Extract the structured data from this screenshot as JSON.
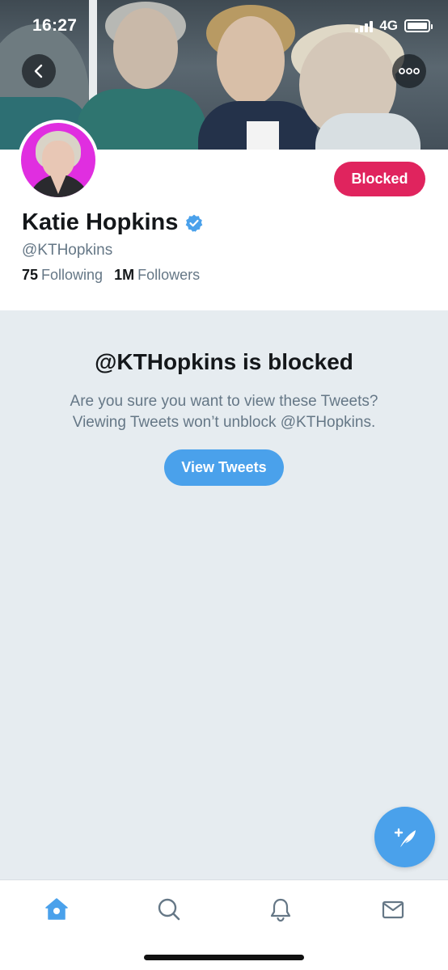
{
  "status_bar": {
    "time": "16:27",
    "network": "4G"
  },
  "profile": {
    "display_name": "Katie Hopkins",
    "handle": "@KTHopkins",
    "verified": true,
    "blocked_label": "Blocked",
    "following_count": "75",
    "following_label": "Following",
    "followers_count": "1M",
    "followers_label": "Followers"
  },
  "blocked_notice": {
    "title": "@KTHopkins is blocked",
    "line1": "Are you sure you want to view these Tweets?",
    "line2": "Viewing Tweets won’t unblock @KTHopkins.",
    "view_button": "View Tweets"
  },
  "icons": {
    "back": "chevron-left-icon",
    "more": "more-horizontal-icon",
    "verified": "verified-badge-icon",
    "compose": "compose-tweet-icon",
    "tabs": [
      "home-icon",
      "search-icon",
      "bell-icon",
      "mail-icon"
    ]
  },
  "colors": {
    "accent": "#4aa1eb",
    "blocked": "#e0245e",
    "text_primary": "#14171a",
    "text_secondary": "#657786",
    "background": "#e6ecf0"
  }
}
